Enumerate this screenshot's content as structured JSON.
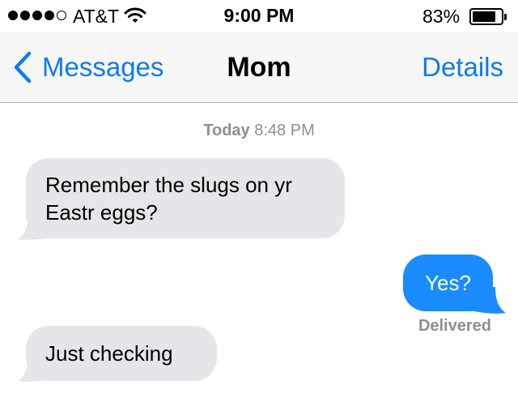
{
  "status_bar": {
    "carrier": "AT&T",
    "signal_bars_filled": 4,
    "signal_bars_total": 5,
    "wifi_icon": "wifi-icon",
    "time": "9:00 PM",
    "battery_percent": "83%",
    "battery_level": 0.83
  },
  "nav_bar": {
    "back_label": "Messages",
    "title": "Mom",
    "details_label": "Details"
  },
  "conversation": {
    "timestamp_day": "Today",
    "timestamp_time": "8:48 PM",
    "messages": [
      {
        "direction": "received",
        "text": "Remember the slugs on yr Eastr eggs?"
      },
      {
        "direction": "sent",
        "text": "Yes?"
      },
      {
        "direction": "received",
        "text": "Just checking"
      }
    ],
    "delivered_label": "Delivered"
  },
  "colors": {
    "accent_blue": "#0e7af5",
    "sent_bubble": "#1a8cff",
    "received_bubble": "#e5e5ea",
    "meta_gray": "#8e8e93"
  }
}
